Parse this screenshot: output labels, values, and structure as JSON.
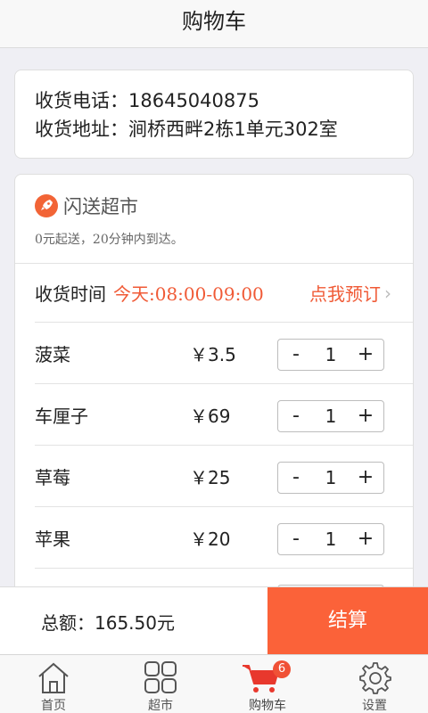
{
  "header": {
    "title": "购物车"
  },
  "address": {
    "phone_line": "收货电话：18645040875",
    "address_line": "收货地址：涧桥西畔2栋1单元302室"
  },
  "shop": {
    "name": "闪送超市",
    "description": "0元起送，20分钟内到达。",
    "delivery_label": "收货时间",
    "delivery_time": "今天:08:00-09:00",
    "book_label": "点我预订",
    "items": [
      {
        "name": "菠菜",
        "price": "￥3.5",
        "qty": "1"
      },
      {
        "name": "车厘子",
        "price": "￥69",
        "qty": "1"
      },
      {
        "name": "草莓",
        "price": "￥25",
        "qty": "1"
      },
      {
        "name": "苹果",
        "price": "￥20",
        "qty": "1"
      }
    ],
    "minus_label": "-",
    "plus_label": "+"
  },
  "footer": {
    "total": "总额：165.50元",
    "checkout_label": "结算"
  },
  "tabs": [
    {
      "label": "首页",
      "icon": "home-icon"
    },
    {
      "label": "超市",
      "icon": "grid-icon"
    },
    {
      "label": "购物车",
      "icon": "cart-icon",
      "badge": "6"
    },
    {
      "label": "设置",
      "icon": "gear-icon"
    }
  ],
  "colors": {
    "accent": "#fb6239",
    "price_red": "#f05a36"
  }
}
